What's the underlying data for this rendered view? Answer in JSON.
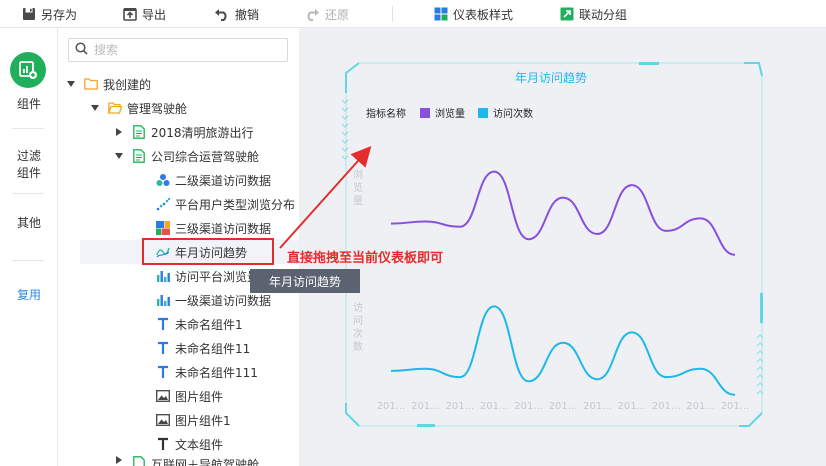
{
  "toolbar": {
    "save_as": "另存为",
    "export": "导出",
    "undo": "撤销",
    "redo": "还原",
    "dashboard_style": "仪表板样式",
    "link_group": "联动分组"
  },
  "leftbar": {
    "component": "组件",
    "filter": "过滤组件",
    "other": "其他",
    "reuse": "复用"
  },
  "search": {
    "placeholder": "搜索"
  },
  "tree": {
    "my_created": "我创建的",
    "cockpit": "管理驾驶舱",
    "travel": "2018清明旅游出行",
    "company": "公司综合运营驾驶舱",
    "items": [
      "二级渠道访问数据",
      "平台用户类型浏览分布",
      "三级渠道访问数据",
      "年月访问趋势",
      "访问平台浏览量",
      "一级渠道访问数据",
      "未命名组件1",
      "未命名组件11",
      "未命名组件111",
      "图片组件",
      "图片组件1",
      "文本组件"
    ],
    "next_folder": "互联网＋导航驾驶舱"
  },
  "tooltip": "年月访问趋势",
  "annotation": "直接拖拽至当前仪表板即可",
  "colors": {
    "accent": "#2c8aea",
    "green": "#20b05c",
    "red": "#e42c2c",
    "purple": "#8a4fdc",
    "cyan": "#1eb8ec",
    "frame": "#5ed6e6"
  },
  "chart_data": {
    "type": "line",
    "title": "年月访问趋势",
    "legend_title": "指标名称",
    "legend_position": "top-left",
    "x": [
      "201...",
      "201...",
      "201...",
      "201...",
      "201...",
      "201...",
      "201...",
      "201...",
      "201...",
      "201...",
      "201..."
    ],
    "series": [
      {
        "name": "浏览量",
        "ylabel": "浏览量",
        "values": [
          35,
          37,
          32,
          85,
          20,
          60,
          25,
          72,
          28,
          40,
          5
        ]
      },
      {
        "name": "访问次数",
        "ylabel": "访问次数",
        "values": [
          28,
          30,
          22,
          90,
          18,
          55,
          20,
          65,
          22,
          30,
          5
        ]
      }
    ]
  }
}
